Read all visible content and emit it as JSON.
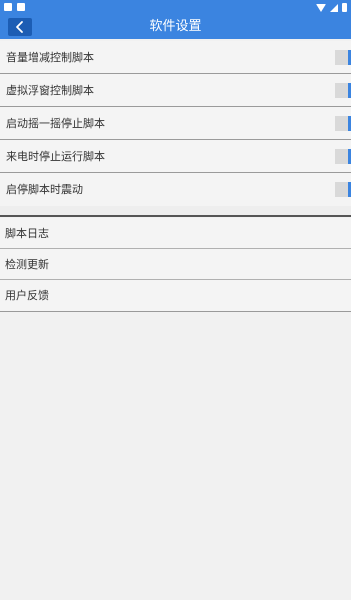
{
  "app_bar": {
    "title": "软件设置"
  },
  "settings": {
    "items": [
      {
        "label": "音量增减控制脚本"
      },
      {
        "label": "虚拟浮窗控制脚本"
      },
      {
        "label": "启动摇一摇停止脚本"
      },
      {
        "label": "来电时停止运行脚本"
      },
      {
        "label": "启停脚本时震动"
      }
    ]
  },
  "menu": {
    "items": [
      {
        "label": "脚本日志"
      },
      {
        "label": "检测更新"
      },
      {
        "label": "用户反馈"
      }
    ]
  },
  "colors": {
    "accent": "#3b84e0",
    "back_button": "#1c5db4",
    "background": "#f1f1f1",
    "toggle_off": "#d9d9d9"
  },
  "icons": {
    "back": "chevron-left-icon",
    "status_wifi": "wifi-icon",
    "status_signal": "signal-icon",
    "status_battery": "battery-icon"
  }
}
